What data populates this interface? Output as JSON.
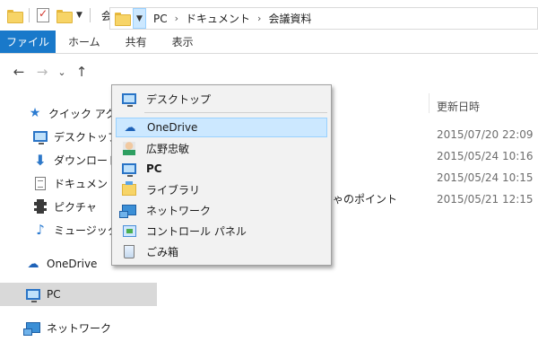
{
  "window": {
    "title": "会議資料"
  },
  "ribbon": {
    "tabs": [
      "ファイル",
      "ホーム",
      "共有",
      "表示"
    ]
  },
  "address": {
    "crumbs": [
      "PC",
      "ドキュメント",
      "会議資料"
    ],
    "separator": "›"
  },
  "nav": {
    "back": "←",
    "forward": "→",
    "recent": "⌄",
    "up": "↑"
  },
  "navpane": {
    "items": [
      "クイック アクセス",
      "デスクトップ",
      "ダウンロード",
      "ドキュメント",
      "ピクチャ",
      "ミュージック",
      "OneDrive",
      "PC",
      "ネットワーク"
    ],
    "selected": "PC"
  },
  "dropdown": {
    "items": [
      "デスクトップ",
      "OneDrive",
      "広野忠敏",
      "PC",
      "ライブラリ",
      "ネットワーク",
      "コントロール パネル",
      "ごみ箱"
    ],
    "highlighted": "OneDrive"
  },
  "content": {
    "column_header": "更新日時",
    "dates": [
      "2015/07/20 22:09",
      "2015/05/24 10:16",
      "2015/05/24 10:15",
      "2015/05/21 12:15"
    ],
    "partial_filename": "ゃのポイント"
  },
  "colors": {
    "accent": "#1979ca",
    "highlight": "#cce8ff",
    "selected": "#d9d9d9"
  }
}
